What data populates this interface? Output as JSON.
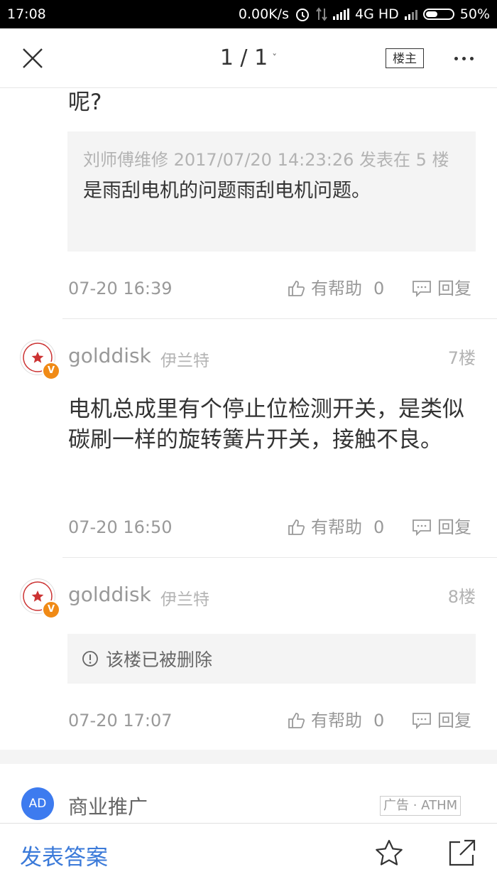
{
  "status_bar": {
    "time": "17:08",
    "speed": "0.00K/s",
    "network": "4G HD",
    "battery": "50%",
    "battery_level": 0.5
  },
  "navbar": {
    "page_indicator": "1 / 1",
    "chevron": "ˇ",
    "louzhu_label": "楼主"
  },
  "post_top": {
    "trailing_text": "呢?",
    "quote": {
      "meta": "刘师傅维修 2017/07/20 14:23:26 发表在 5 楼",
      "text": "是雨刮电机的问题雨刮电机问题。"
    },
    "date": "07-20 16:39",
    "helpful_label": "有帮助",
    "helpful_count": "0",
    "reply_label": "回复"
  },
  "post_7": {
    "username": "golddisk",
    "car": "伊兰特",
    "floor": "7楼",
    "verified": "V",
    "body": "电机总成里有个停止位检测开关，是类似碳刷一样的旋转簧片开关，接触不良。",
    "date": "07-20 16:50",
    "helpful_label": "有帮助",
    "helpful_count": "0",
    "reply_label": "回复"
  },
  "post_8": {
    "username": "golddisk",
    "car": "伊兰特",
    "floor": "8楼",
    "verified": "V",
    "deleted_text": "该楼已被删除",
    "date": "07-20 17:07",
    "helpful_label": "有帮助",
    "helpful_count": "0",
    "reply_label": "回复"
  },
  "ad": {
    "badge": "AD",
    "title": "商业推广",
    "tag": "广告 · ATHM",
    "badge_color": "#3d7bef"
  },
  "bottom_bar": {
    "answer_label": "发表答案",
    "answer_color": "#3b7ad9"
  },
  "icons": {
    "close": "close-icon",
    "more": "more-icon",
    "thumb": "thumbs-up-icon",
    "reply": "comment-icon",
    "info": "info-icon",
    "star": "star-icon",
    "share": "share-icon"
  }
}
